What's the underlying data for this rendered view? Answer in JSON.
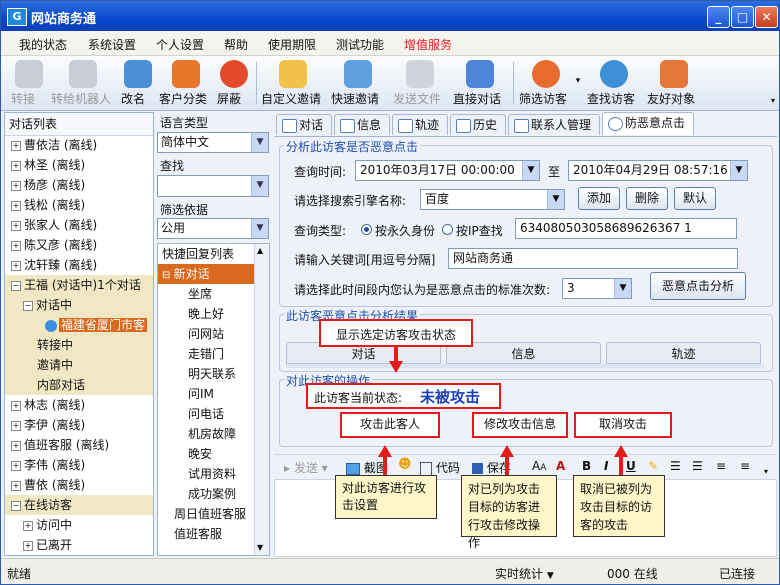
{
  "window": {
    "title": "网站商务通",
    "minimize": "_",
    "maximize": "□",
    "close": "✕"
  },
  "menu": [
    "我的状态",
    "系统设置",
    "个人设置",
    "帮助",
    "使用期限",
    "测试功能",
    "增值服务"
  ],
  "colors": {
    "highlight_menu": "#e02020",
    "accent": "#d9691f",
    "title_bar": "#0a48cc",
    "annotation_red": "#e31b1b"
  },
  "toolbar": [
    {
      "label": "转接",
      "icon": "transfer-icon",
      "enabled": false
    },
    {
      "label": "转给机器人",
      "icon": "robot-icon",
      "enabled": false
    },
    {
      "label": "改名",
      "icon": "rename-icon",
      "enabled": true
    },
    {
      "label": "客户分类",
      "icon": "customer-group-icon",
      "enabled": true
    },
    {
      "label": "屏蔽",
      "icon": "block-icon",
      "enabled": true
    },
    {
      "label": "自定义邀请",
      "icon": "custom-invite-icon",
      "enabled": true
    },
    {
      "label": "快速邀请",
      "icon": "quick-invite-icon",
      "enabled": true
    },
    {
      "label": "发送文件",
      "icon": "send-file-icon",
      "enabled": false
    },
    {
      "label": "直接对话",
      "icon": "direct-chat-icon",
      "enabled": true
    },
    {
      "label": "筛选访客",
      "icon": "filter-visitor-icon",
      "enabled": true
    },
    {
      "label": "查找访客",
      "icon": "find-visitor-icon",
      "enabled": true
    },
    {
      "label": "友好对象",
      "icon": "friendly-contact-icon",
      "enabled": true
    }
  ],
  "left_panel": {
    "header": "对话列表",
    "rows": [
      {
        "expander": "+",
        "text": "曹依洁 (离线)"
      },
      {
        "expander": "+",
        "text": "林圣 (离线)"
      },
      {
        "expander": "+",
        "text": "杨彦 (离线)"
      },
      {
        "expander": "+",
        "text": "钱松 (离线)"
      },
      {
        "expander": "+",
        "text": "张家人 (离线)"
      },
      {
        "expander": "+",
        "text": "陈又彦 (离线)"
      },
      {
        "expander": "+",
        "text": "沈轩臻 (离线)"
      },
      {
        "expander": "−",
        "text": "王福 (对话中)1个对话"
      },
      {
        "expander": "−",
        "text": "对话中"
      },
      {
        "expander": "",
        "text": "福建省厦门市客"
      },
      {
        "expander": "",
        "text": "转接中"
      },
      {
        "expander": "",
        "text": "邀请中"
      },
      {
        "expander": "",
        "text": "内部对话"
      },
      {
        "expander": "+",
        "text": "林志 (离线)"
      },
      {
        "expander": "+",
        "text": "李伊 (离线)"
      },
      {
        "expander": "+",
        "text": "值班客服 (离线)"
      },
      {
        "expander": "+",
        "text": "李伟 (离线)"
      },
      {
        "expander": "+",
        "text": "曹依 (离线)"
      },
      {
        "expander": "−",
        "text": "在线访客"
      },
      {
        "expander": "+",
        "text": "访问中"
      },
      {
        "expander": "+",
        "text": "已离开"
      }
    ]
  },
  "mid_panel": {
    "language_label": "语言类型",
    "language_value": "简体中文",
    "search_label": "查找",
    "search_value": "",
    "filter_label": "筛选依据",
    "filter_value": "公用",
    "quick_reply_header": "快捷回复列表",
    "quick_reply_items": [
      "新对话",
      "坐席",
      "晚上好",
      "问网站",
      "走错门",
      "明天联系",
      "问IM",
      "问电话",
      "机房故障",
      "晚安",
      "试用资料",
      "成功案例",
      "周日值班客服",
      "值班客服"
    ]
  },
  "tabs": [
    {
      "label": "对话",
      "icon": "chat-tab-icon"
    },
    {
      "label": "信息",
      "icon": "info-tab-icon"
    },
    {
      "label": "轨迹",
      "icon": "track-tab-icon"
    },
    {
      "label": "历史",
      "icon": "history-tab-icon"
    },
    {
      "label": "联系人管理",
      "icon": "contacts-tab-icon"
    },
    {
      "label": "防恶意点击",
      "icon": "anti-click-tab-icon"
    }
  ],
  "analysis": {
    "legend": "分析此访客是否恶意点击",
    "query_time_label": "查询时间:",
    "start_time": "2010年03月17日 00:00:00",
    "to": "至",
    "end_time": "2010年04月29日 08:57:16",
    "engine_label": "请选择搜索引擎名称:",
    "engine_value": "百度",
    "add_button": "添加",
    "delete_button": "删除",
    "default_button": "默认",
    "query_type_label": "查询类型:",
    "radio_identity": "按永久身份",
    "radio_ip": "按IP查找",
    "identity_value": "634080503058689626367 1",
    "keyword_label": "请输入关键词[用逗号分隔]",
    "keyword_value": "网站商务通",
    "threshold_label": "请选择此时间段内您认为是恶意点击的标准次数:",
    "threshold_value": "3",
    "analyze_button": "恶意点击分析"
  },
  "results": {
    "legend": "此访客恶意点击分析结果",
    "subtabs": [
      "对话",
      "信息",
      "轨迹"
    ],
    "callout": "显示选定访客攻击状态"
  },
  "operations": {
    "legend": "对此访客的操作",
    "status_label": "此访客当前状态:",
    "status_value": "未被攻击",
    "attack_button": "攻击此客人",
    "modify_button": "修改攻击信息",
    "cancel_button": "取消攻击"
  },
  "annotations": {
    "attack_note": "对此访客进行攻击设置",
    "modify_note_1": "对已列为攻击",
    "modify_note_2": "目标的访客进",
    "modify_note_3": "行攻击修改操作",
    "cancel_note_1": "取消已被列为",
    "cancel_note_2": "攻击目标的访",
    "cancel_note_3": "客的攻击"
  },
  "editor_toolbar": {
    "send": "发送",
    "screenshot": "截图",
    "code": "代码",
    "save": "保存",
    "bold": "B",
    "italic": "I",
    "underline": "U"
  },
  "statusbar": {
    "ready": "就绪",
    "stats": "实时统计",
    "online": "000 在线",
    "connected": "已连接"
  }
}
